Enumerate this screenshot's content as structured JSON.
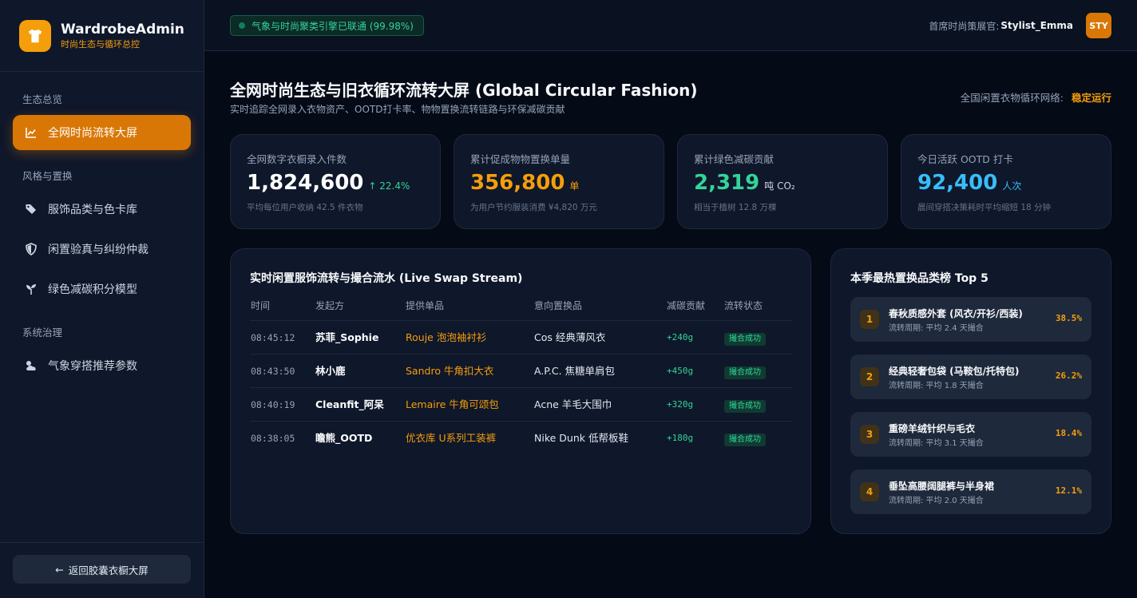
{
  "brand": {
    "title": "WardrobeAdmin",
    "subtitle": "时尚生态与循环总控",
    "icon": "tshirt-icon"
  },
  "sidebar": {
    "sections": [
      {
        "title": "生态总览"
      },
      {
        "title": "风格与置换"
      },
      {
        "title": "系统治理"
      }
    ],
    "items": [
      {
        "label": "全网时尚流转大屏",
        "icon": "chart-line-icon",
        "active": true
      },
      {
        "label": "服饰品类与色卡库",
        "icon": "tags-icon"
      },
      {
        "label": "闲置验真与纠纷仲裁",
        "icon": "shield-icon"
      },
      {
        "label": "绿色减碳积分模型",
        "icon": "seedling-icon"
      },
      {
        "label": "气象穿搭推荐参数",
        "icon": "cloud-sun-icon"
      }
    ],
    "back_label": "返回胶囊衣橱大屏"
  },
  "header": {
    "status": "气象与时尚聚类引擎已联通 (99.98%)",
    "role_label": "首席时尚策展官:",
    "user_name": "Stylist_Emma",
    "avatar_text": "STY"
  },
  "page": {
    "title": "全网时尚生态与旧衣循环流转大屏 (Global Circular Fashion)",
    "subtitle": "实时追踪全网录入衣物资产、OOTD打卡率、物物置换流转链路与环保减碳贡献",
    "network_label": "全国闲置衣物循环网络:",
    "network_status": "稳定运行"
  },
  "stats": [
    {
      "label": "全网数字衣橱录入件数",
      "value": "1,824,600",
      "unit": "↑ 22.4%",
      "note": "平均每位用户收纳 42.5 件衣物",
      "color": "#ffffff",
      "unit_color": "#34d399"
    },
    {
      "label": "累计促成物物置换单量",
      "value": "356,800",
      "unit": "单",
      "note": "为用户节约服装消费 ¥4,820 万元",
      "color": "#f59e0b",
      "unit_color": "#f59e0b"
    },
    {
      "label": "累计绿色减碳贡献",
      "value": "2,319",
      "unit": "吨 CO₂",
      "note": "相当于植树 12.8 万棵",
      "color": "#34d399",
      "unit_color": "#cbd5e1"
    },
    {
      "label": "今日活跃 OOTD 打卡",
      "value": "92,400",
      "unit": "人次",
      "note": "晨间穿搭决策耗时平均缩短 18 分钟",
      "color": "#38bdf8",
      "unit_color": "#38bdf8"
    }
  ],
  "stream": {
    "title": "实时闲置服饰流转与撮合流水 (Live Swap Stream)",
    "columns": [
      "时间",
      "发起方",
      "提供单品",
      "意向置换品",
      "减碳贡献",
      "流转状态"
    ],
    "rows": [
      {
        "time": "08:45:12",
        "from": "苏菲_Sophie",
        "item": "Rouje 泡泡袖衬衫",
        "want": "Cos 经典薄风衣",
        "carbon": "+240g",
        "status": "撮合成功"
      },
      {
        "time": "08:43:50",
        "from": "林小鹿",
        "item": "Sandro 牛角扣大衣",
        "want": "A.P.C. 焦糖单肩包",
        "carbon": "+450g",
        "status": "撮合成功"
      },
      {
        "time": "08:40:19",
        "from": "Cleanfit_阿呆",
        "item": "Lemaire 牛角可颂包",
        "want": "Acne 羊毛大围巾",
        "carbon": "+320g",
        "status": "撮合成功"
      },
      {
        "time": "08:38:05",
        "from": "瞻熊_OOTD",
        "item": "优衣库 U系列工装裤",
        "want": "Nike Dunk 低帮板鞋",
        "carbon": "+180g",
        "status": "撮合成功"
      }
    ]
  },
  "ranking": {
    "title": "本季最热置换品类榜 Top 5",
    "items": [
      {
        "rank": "1",
        "name": "春秋质感外套 (风衣/开衫/西装)",
        "cycle": "流转周期: 平均 2.4 天撮合",
        "pct": "38.5%"
      },
      {
        "rank": "2",
        "name": "经典轻奢包袋 (马鞍包/托特包)",
        "cycle": "流转周期: 平均 1.8 天撮合",
        "pct": "26.2%"
      },
      {
        "rank": "3",
        "name": "重磅羊绒针织与毛衣",
        "cycle": "流转周期: 平均 3.1 天撮合",
        "pct": "18.4%"
      },
      {
        "rank": "4",
        "name": "垂坠高腰阔腿裤与半身裙",
        "cycle": "流转周期: 平均 2.0 天撮合",
        "pct": "12.1%"
      }
    ]
  }
}
